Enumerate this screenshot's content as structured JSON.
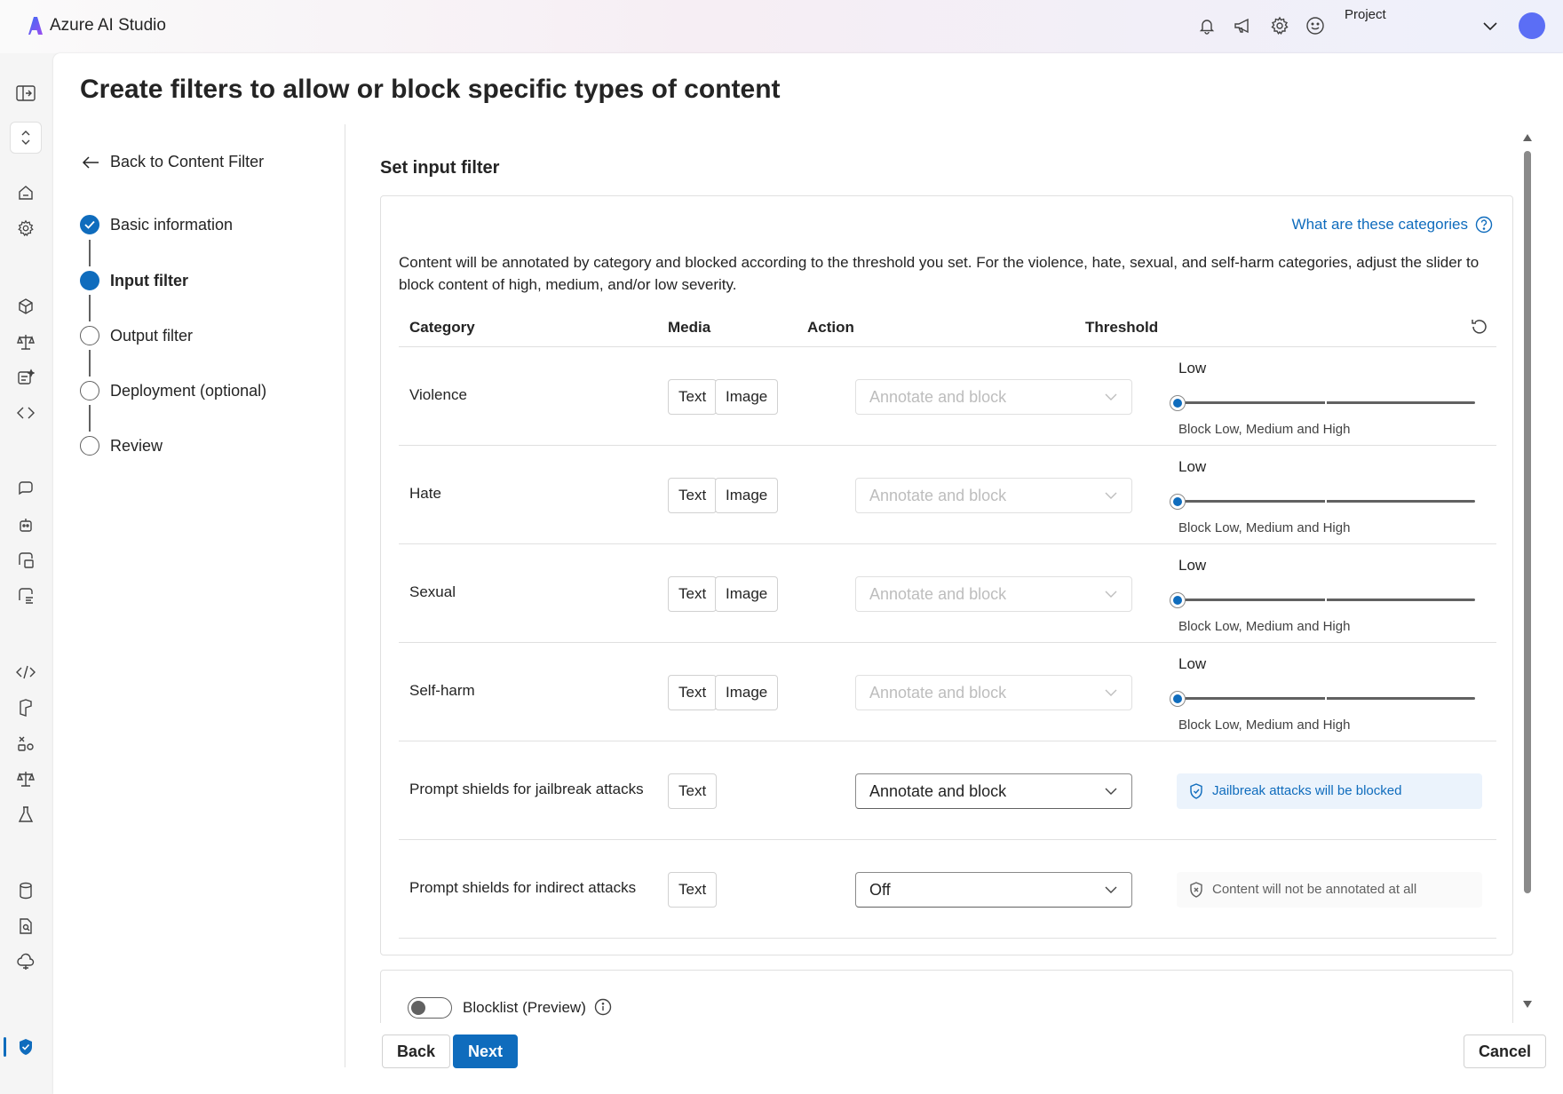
{
  "app": {
    "title": "Azure AI Studio",
    "project_label": "Project"
  },
  "page": {
    "title": "Create filters to allow or block specific types of content"
  },
  "nav": {
    "back_link": "Back to Content Filter",
    "steps": [
      {
        "label": "Basic information",
        "state": "done"
      },
      {
        "label": "Input filter",
        "state": "current"
      },
      {
        "label": "Output filter",
        "state": "pending"
      },
      {
        "label": "Deployment (optional)",
        "state": "pending"
      },
      {
        "label": "Review",
        "state": "pending"
      }
    ]
  },
  "section": {
    "title": "Set input filter",
    "help_link": "What are these categories",
    "description": "Content will be annotated by category and blocked according to the threshold you set. For the violence, hate, sexual, and self-harm categories, adjust the slider to block content of high, medium, and/or low severity.",
    "columns": {
      "category": "Category",
      "media": "Media",
      "action": "Action",
      "threshold": "Threshold"
    }
  },
  "rows": [
    {
      "category": "Violence",
      "media": [
        "Text",
        "Image"
      ],
      "action": "Annotate and block",
      "threshold_label": "Low",
      "threshold_note": "Block Low, Medium and High"
    },
    {
      "category": "Hate",
      "media": [
        "Text",
        "Image"
      ],
      "action": "Annotate and block",
      "threshold_label": "Low",
      "threshold_note": "Block Low, Medium and High"
    },
    {
      "category": "Sexual",
      "media": [
        "Text",
        "Image"
      ],
      "action": "Annotate and block",
      "threshold_label": "Low",
      "threshold_note": "Block Low, Medium and High"
    },
    {
      "category": "Self-harm",
      "media": [
        "Text",
        "Image"
      ],
      "action": "Annotate and block",
      "threshold_label": "Low",
      "threshold_note": "Block Low, Medium and High"
    },
    {
      "category": "Prompt shields for jailbreak attacks",
      "media": [
        "Text"
      ],
      "action": "Annotate and block",
      "status": "Jailbreak attacks will be blocked"
    },
    {
      "category": "Prompt shields for indirect attacks",
      "media": [
        "Text"
      ],
      "action": "Off",
      "status": "Content will not be annotated at all"
    }
  ],
  "blocklist": {
    "label": "Blocklist (Preview)",
    "enabled": false
  },
  "footer": {
    "back": "Back",
    "next": "Next",
    "cancel": "Cancel"
  },
  "colors": {
    "accent": "#0f6cbd",
    "border": "#e0e0e0",
    "avatar": "#5b6ef5"
  },
  "icons": {
    "top": [
      "bell-icon",
      "megaphone-icon",
      "gear-icon",
      "smiley-icon",
      "chevron-down-icon"
    ],
    "rail": [
      "panel-toggle-icon",
      "expand-collapse-icon",
      "home-icon",
      "settings-icon",
      "cube-icon",
      "scale-icon",
      "prompt-catalog-icon",
      "model-swap-icon",
      "chat-icon",
      "robot-icon",
      "image-chat-icon",
      "speech-icon",
      "code-icon",
      "prompt-flow-icon",
      "tracing-icon",
      "evaluation-icon",
      "flask-icon",
      "data-icon",
      "indexes-icon",
      "deploy-cloud-icon",
      "shield-icon"
    ]
  }
}
